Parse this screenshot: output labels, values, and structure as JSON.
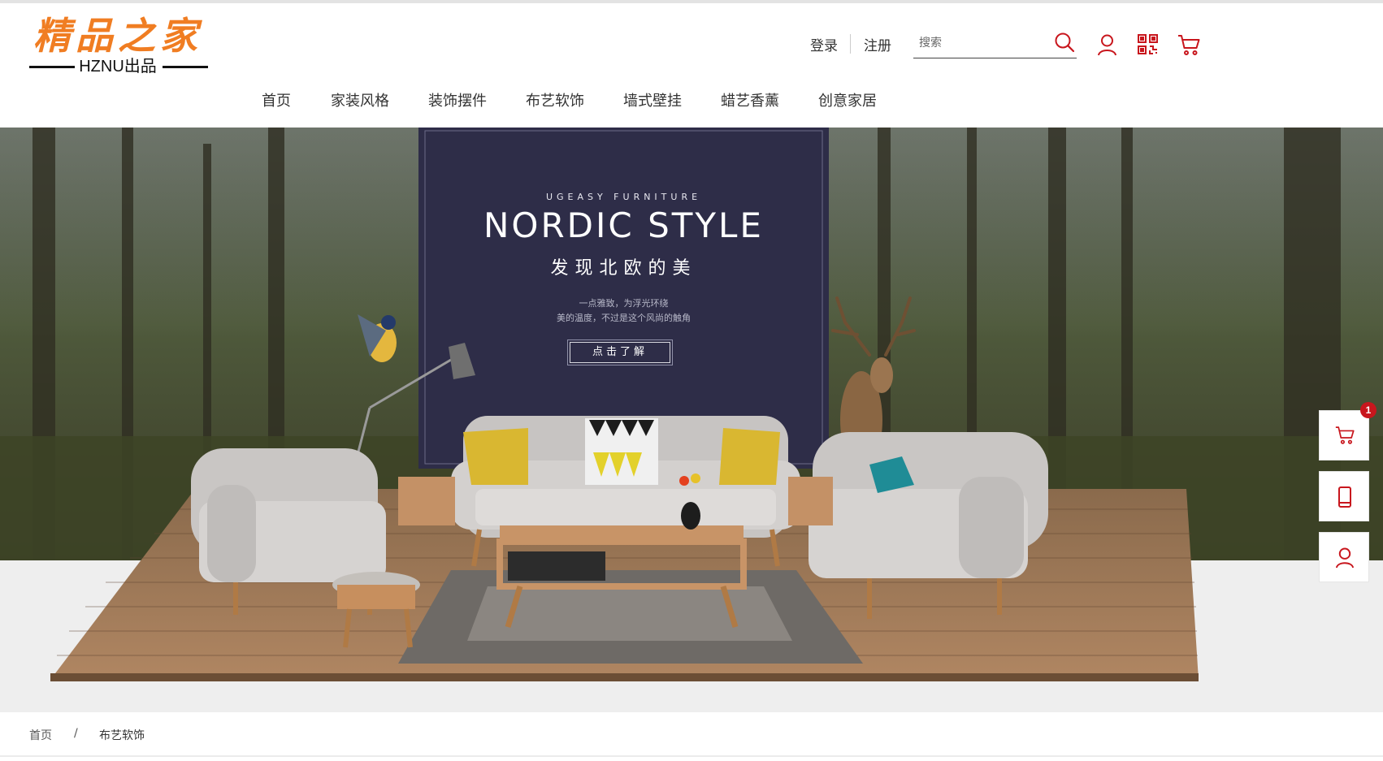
{
  "header": {
    "logo": {
      "title": "精品之家",
      "subtitle": "HZNU出品"
    },
    "login_label": "登录",
    "register_label": "注册",
    "search": {
      "placeholder": "搜索"
    },
    "icons": [
      "search-icon",
      "user-icon",
      "qr-code-icon",
      "cart-icon"
    ],
    "accent_color": "#c8161d"
  },
  "nav": {
    "items": [
      {
        "label": "首页"
      },
      {
        "label": "家装风格"
      },
      {
        "label": "装饰摆件"
      },
      {
        "label": "布艺软饰"
      },
      {
        "label": "墙式壁挂"
      },
      {
        "label": "蜡艺香薰"
      },
      {
        "label": "创意家居"
      }
    ]
  },
  "banner": {
    "brand": "UGEASY FURNITURE",
    "title": "NORDIC STYLE",
    "subtitle_cn": "发现北欧的美",
    "tagline_1": "一点雅致，为浮光环绕",
    "tagline_2": "美的温度，不过是这个风尚的触角",
    "cta_label": "点击了解"
  },
  "side_toolbar": {
    "cart_badge": "1",
    "icons": [
      "cart-icon",
      "mobile-phone-icon",
      "user-icon"
    ]
  },
  "breadcrumb": {
    "home": "首页",
    "separator": "/",
    "current": "布艺软饰"
  }
}
